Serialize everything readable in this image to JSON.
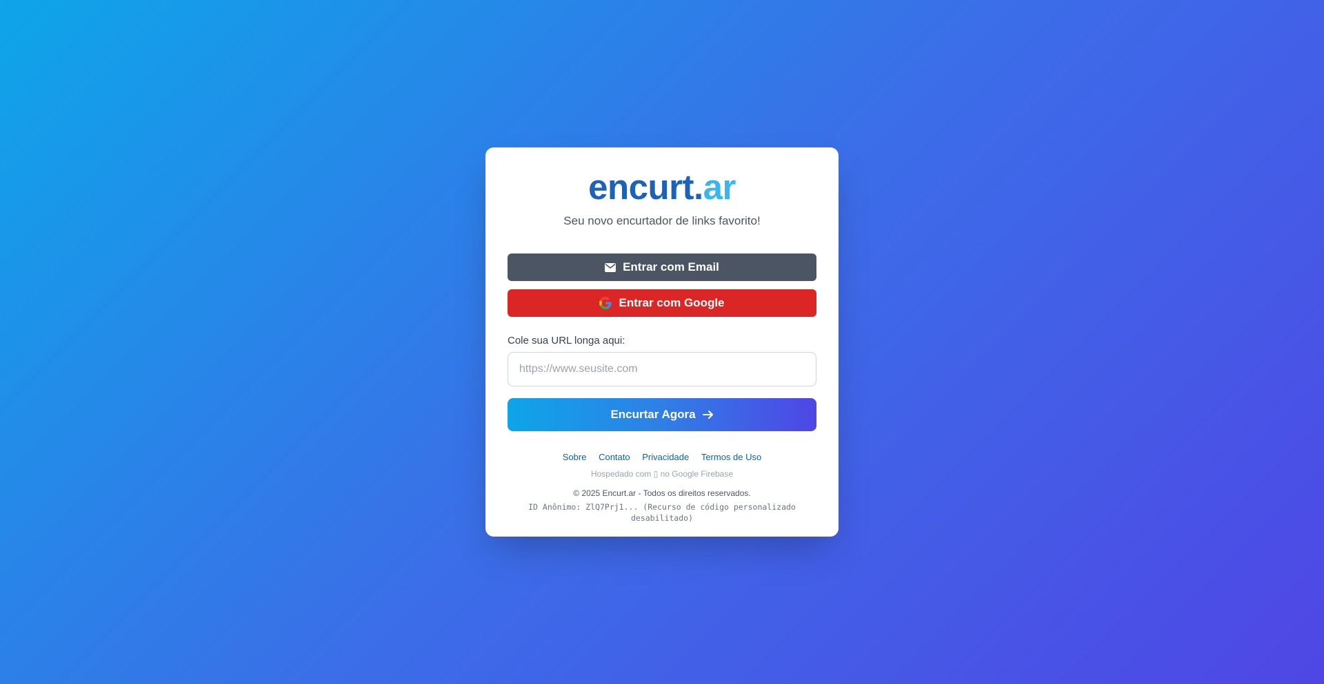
{
  "brand": {
    "name_part1": "encurt.",
    "name_part2": "ar",
    "tagline": "Seu novo encurtador de links favorito!"
  },
  "auth": {
    "email_button": "Entrar com Email",
    "google_button": "Entrar com Google"
  },
  "shortener": {
    "url_label": "Cole sua URL longa aqui:",
    "url_placeholder": "https://www.seusite.com",
    "url_value": "",
    "submit_label": "Encurtar Agora"
  },
  "footer": {
    "links": [
      {
        "label": "Sobre"
      },
      {
        "label": "Contato"
      },
      {
        "label": "Privacidade"
      },
      {
        "label": "Termos de Uso"
      }
    ],
    "hosted": "Hospedado com ▯ no Google Firebase",
    "copyright": "© 2025 Encurt.ar - Todos os direitos reservados.",
    "anon_id": "ID Anônimo: ZlQ7Prj1... (Recurso de código personalizado desabilitado)"
  },
  "colors": {
    "background_start": "#0ea5e9",
    "background_end": "#4f46e5",
    "email_button": "#4b5563",
    "google_button": "#dc2626",
    "brand_primary": "#1e62b8",
    "brand_accent": "#38b6ee",
    "link": "#0369a1"
  },
  "icons": {
    "email": "envelope-icon",
    "google": "google-logo-icon",
    "submit": "arrow-right-icon"
  }
}
